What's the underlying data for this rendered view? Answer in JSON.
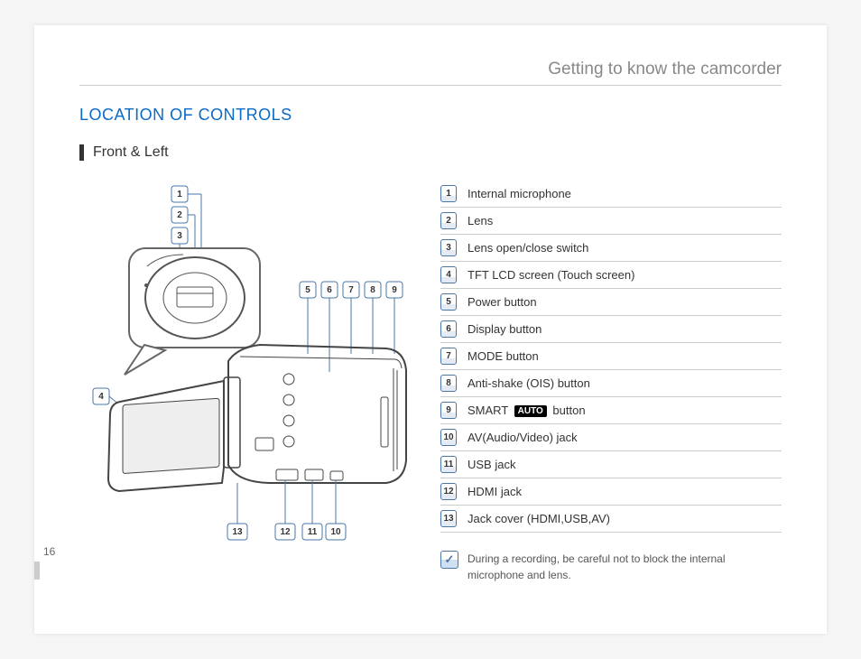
{
  "chapter": "Getting to know the camcorder",
  "section_title": "LOCATION OF CONTROLS",
  "subheading": "Front & Left",
  "page_number": "16",
  "legend": [
    {
      "num": "1",
      "label": "Internal microphone"
    },
    {
      "num": "2",
      "label": "Lens"
    },
    {
      "num": "3",
      "label": "Lens open/close switch"
    },
    {
      "num": "4",
      "label": "TFT LCD screen (Touch screen)"
    },
    {
      "num": "5",
      "label": "Power button"
    },
    {
      "num": "6",
      "label": "Display button"
    },
    {
      "num": "7",
      "label": "MODE button"
    },
    {
      "num": "8",
      "label": "Anti-shake (OIS) button"
    },
    {
      "num": "9",
      "label_pre": "SMART ",
      "badge": "AUTO",
      "label_post": " button"
    },
    {
      "num": "10",
      "label": "AV(Audio/Video) jack"
    },
    {
      "num": "11",
      "label": "USB jack"
    },
    {
      "num": "12",
      "label": "HDMI jack"
    },
    {
      "num": "13",
      "label": "Jack cover (HDMI,USB,AV)"
    }
  ],
  "note_text": "During a recording, be careful not to block the internal microphone and lens.",
  "callouts_top_left": [
    "1",
    "2",
    "3"
  ],
  "callouts_top_right": [
    "5",
    "6",
    "7",
    "8",
    "9"
  ],
  "callout_left": "4",
  "callouts_bottom": [
    "13",
    "12",
    "11",
    "10"
  ]
}
